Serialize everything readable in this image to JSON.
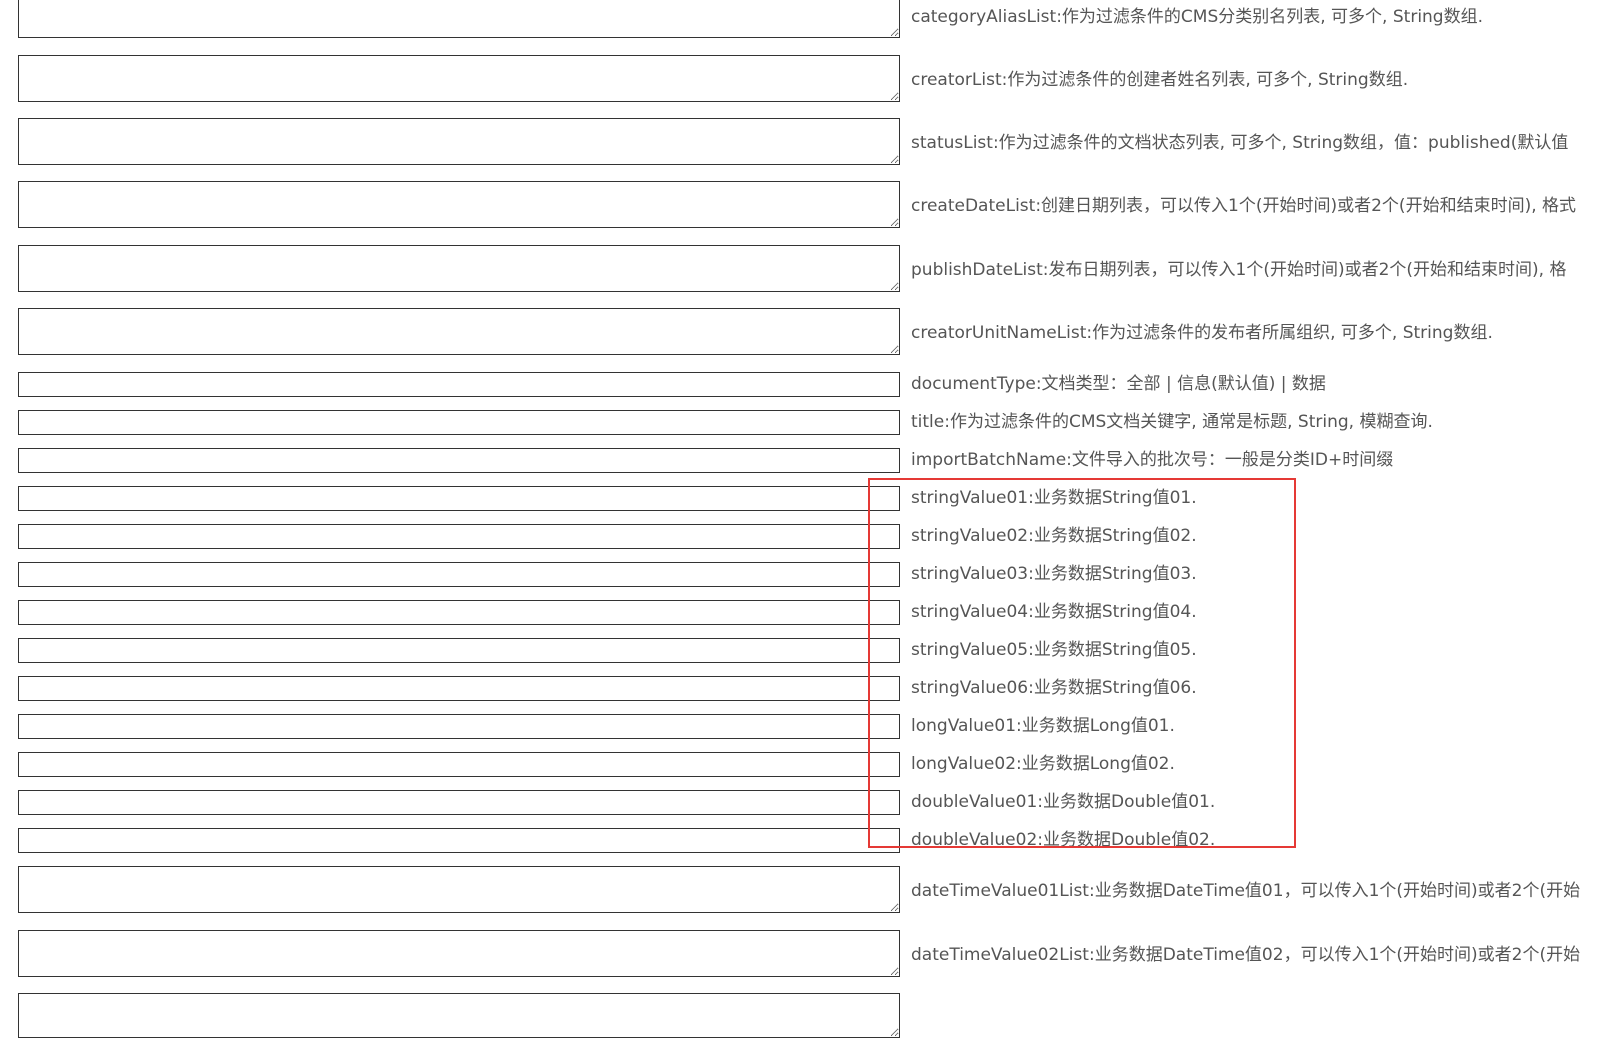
{
  "fields": [
    {
      "id": "categoryAliasList",
      "label": "categoryAliasList:作为过滤条件的CMS分类别名列表, 可多个, String数组.",
      "value": ""
    },
    {
      "id": "creatorList",
      "label": "creatorList:作为过滤条件的创建者姓名列表, 可多个, String数组.",
      "value": ""
    },
    {
      "id": "statusList",
      "label": "statusList:作为过滤条件的文档状态列表, 可多个, String数组，值：published(默认值",
      "value": ""
    },
    {
      "id": "createDateList",
      "label": "createDateList:创建日期列表，可以传入1个(开始时间)或者2个(开始和结束时间), 格式",
      "value": ""
    },
    {
      "id": "publishDateList",
      "label": "publishDateList:发布日期列表，可以传入1个(开始时间)或者2个(开始和结束时间), 格",
      "value": ""
    },
    {
      "id": "creatorUnitNameList",
      "label": "creatorUnitNameList:作为过滤条件的发布者所属组织, 可多个, String数组.",
      "value": ""
    },
    {
      "id": "documentType",
      "label": "documentType:文档类型：全部 | 信息(默认值) | 数据",
      "value": ""
    },
    {
      "id": "title",
      "label": "title:作为过滤条件的CMS文档关键字, 通常是标题, String, 模糊查询.",
      "value": ""
    },
    {
      "id": "importBatchName",
      "label": "importBatchName:文件导入的批次号：一般是分类ID+时间缀",
      "value": ""
    },
    {
      "id": "stringValue01",
      "label": "stringValue01:业务数据String值01.",
      "value": ""
    },
    {
      "id": "stringValue02",
      "label": "stringValue02:业务数据String值02.",
      "value": ""
    },
    {
      "id": "stringValue03",
      "label": "stringValue03:业务数据String值03.",
      "value": ""
    },
    {
      "id": "stringValue04",
      "label": "stringValue04:业务数据String值04.",
      "value": ""
    },
    {
      "id": "stringValue05",
      "label": "stringValue05:业务数据String值05.",
      "value": ""
    },
    {
      "id": "stringValue06",
      "label": "stringValue06:业务数据String值06.",
      "value": ""
    },
    {
      "id": "longValue01",
      "label": "longValue01:业务数据Long值01.",
      "value": ""
    },
    {
      "id": "longValue02",
      "label": "longValue02:业务数据Long值02.",
      "value": ""
    },
    {
      "id": "doubleValue01",
      "label": "doubleValue01:业务数据Double值01.",
      "value": ""
    },
    {
      "id": "doubleValue02",
      "label": "doubleValue02:业务数据Double值02.",
      "value": ""
    },
    {
      "id": "dateTimeValue01List",
      "label": "dateTimeValue01List:业务数据DateTime值01，可以传入1个(开始时间)或者2个(开始",
      "value": ""
    },
    {
      "id": "dateTimeValue02List",
      "label": "dateTimeValue02List:业务数据DateTime值02，可以传入1个(开始时间)或者2个(开始",
      "value": ""
    },
    {
      "id": "dateTimeValue03List",
      "label": "",
      "value": ""
    }
  ],
  "highlight_color": "#e53935"
}
